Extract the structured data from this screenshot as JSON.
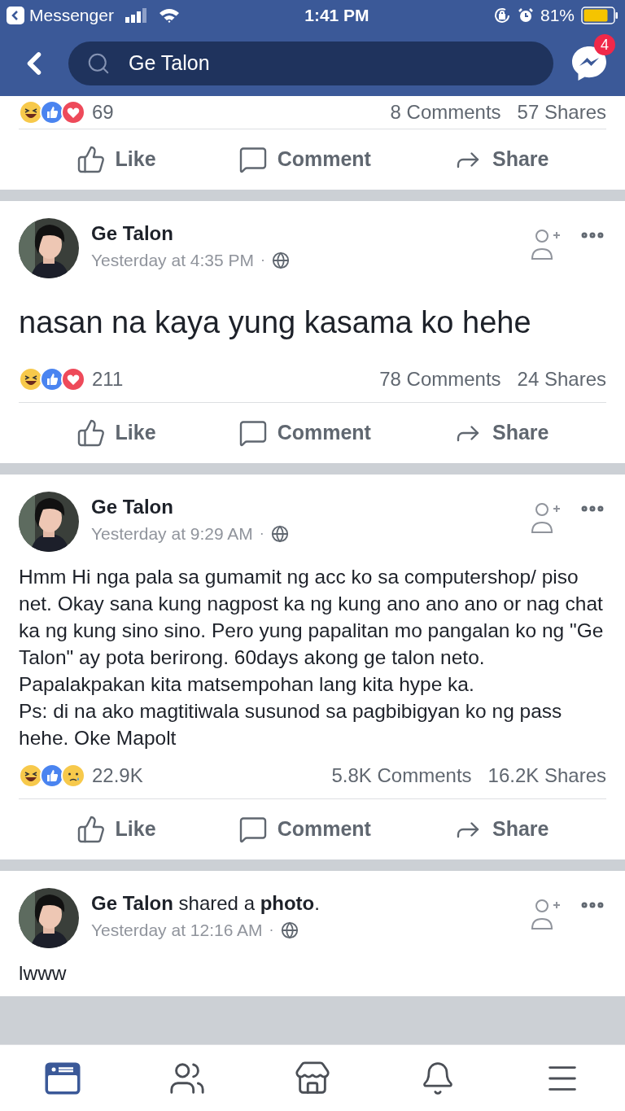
{
  "status_bar": {
    "back_app": "Messenger",
    "time": "1:41 PM",
    "battery": "81%"
  },
  "header": {
    "search": {
      "value": "Ge Talon"
    },
    "messenger_badge": "4"
  },
  "posts": [
    {
      "kind": "partial",
      "reactions": [
        {
          "kind": "haha"
        },
        {
          "kind": "like"
        },
        {
          "kind": "love"
        }
      ],
      "reaction_count": "69",
      "comments": "8 Comments",
      "shares": "57 Shares",
      "actions": [
        "Like",
        "Comment",
        "Share"
      ]
    },
    {
      "kind": "status",
      "author_line": "Ge Talon",
      "time": "Yesterday at 4:35 PM",
      "separator": "·",
      "large_text": true,
      "body": [
        "nasan na kaya yung kasama ko hehe"
      ],
      "reactions": [
        {
          "kind": "haha"
        },
        {
          "kind": "like"
        },
        {
          "kind": "love"
        }
      ],
      "reaction_count": "211",
      "comments": "78 Comments",
      "shares": "24 Shares",
      "actions": [
        "Like",
        "Comment",
        "Share"
      ]
    },
    {
      "kind": "status",
      "author_line": "Ge Talon",
      "time": "Yesterday at 9:29 AM",
      "separator": "·",
      "large_text": false,
      "body": [
        "Hmm Hi nga pala sa gumamit ng acc ko sa computershop/ piso net. Okay sana kung nagpost ka ng kung ano ano ano or nag chat ka ng kung sino sino. Pero yung papalitan mo pangalan ko ng \"Ge Talon\" ay pota berirong. 60days akong ge talon neto. Papalakpakan kita matsempohan lang kita hype ka.",
        "Ps: di na ako magtitiwala susunod sa pagbibigyan ko ng pass hehe. Oke Mapolt"
      ],
      "reactions": [
        {
          "kind": "haha"
        },
        {
          "kind": "like"
        },
        {
          "kind": "sad"
        }
      ],
      "reaction_count": "22.9K",
      "comments": "5.8K Comments",
      "shares": "16.2K Shares",
      "actions": [
        "Like",
        "Comment",
        "Share"
      ]
    },
    {
      "kind": "shared",
      "author_line": "**Ge Talon** shared a **photo**.",
      "time": "Yesterday at 12:16 AM",
      "separator": "·",
      "large_text": false,
      "body": [
        "lwww"
      ]
    }
  ],
  "bottom_nav": [
    {
      "selected": true
    },
    {
      "selected": false
    },
    {
      "selected": false
    },
    {
      "selected": false
    },
    {
      "selected": false
    }
  ]
}
